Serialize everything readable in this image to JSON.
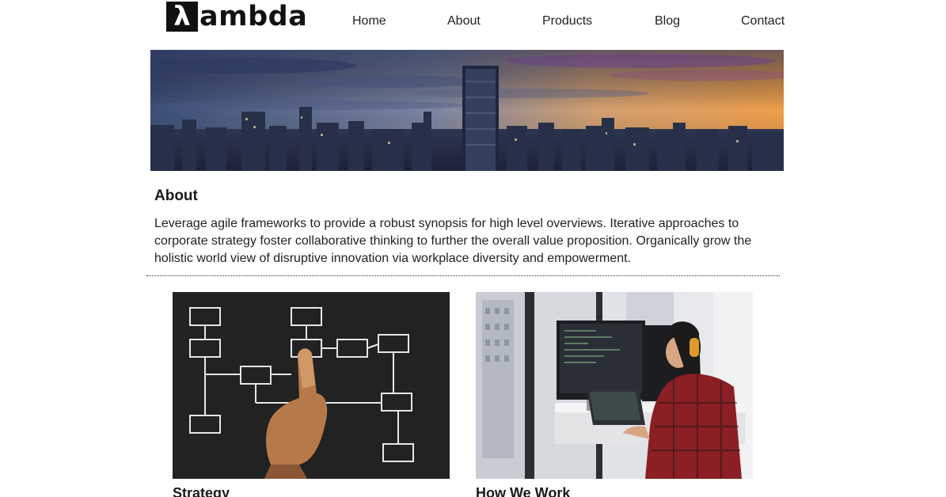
{
  "brand": {
    "logo_mark": "λ",
    "logo_text": "ambda"
  },
  "nav": {
    "items": [
      "Home",
      "About",
      "Products",
      "Blog",
      "Contact"
    ]
  },
  "hero": {
    "image": "city-skyline-sunset"
  },
  "about": {
    "title": "About",
    "body": "Leverage agile frameworks to provide a robust synopsis for high level overviews. Iterative approaches to corporate strategy foster collaborative thinking to further the overall value proposition. Organically grow the holistic world view of disruptive innovation via workplace diversity and empowerment."
  },
  "cards": [
    {
      "title": "Strategy",
      "image": "flowchart-chalkboard-hand"
    },
    {
      "title": "How We Work",
      "image": "woman-at-standing-desk-monitors"
    }
  ],
  "colors": {
    "text": "#1a1a1a",
    "logo": "#111111",
    "divider": "#333333"
  }
}
